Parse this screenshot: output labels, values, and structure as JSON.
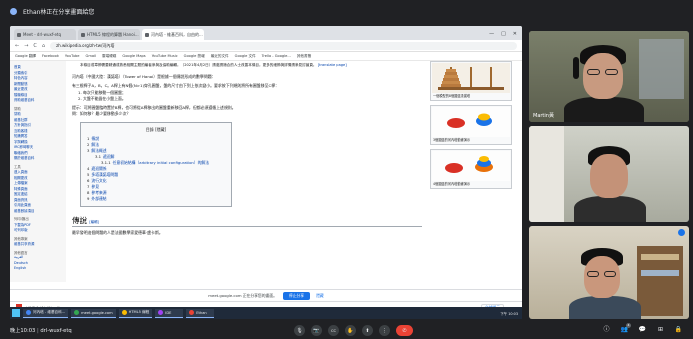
{
  "meeting": {
    "presenting_title": "Ethan林正在分享畫面給您",
    "code": "drl-wuxf-etq",
    "time": "晚上10:03"
  },
  "browser": {
    "tabs": [
      {
        "label": "Meet - drl-wuxf-etq",
        "active": false
      },
      {
        "label": "HTML5 線程的算題 Hanoi...",
        "active": false
      },
      {
        "label": "河內塔 - 維基百科，自由的...",
        "active": true
      }
    ],
    "window_controls": [
      "—",
      "□",
      "✕"
    ],
    "nav": [
      "←",
      "→",
      "C",
      "⌂"
    ],
    "url": "zh.wikipedia.org/zh-tw/河內塔",
    "bookmarks": [
      "Google 翻譯",
      "Facebook",
      "YouTube",
      "Gmail",
      "雲端硬碟",
      "Google Maps",
      "YouTube Music",
      "Google 簡報",
      "最近的文件",
      "Google 文件",
      "Trello - Google...",
      "其他書籤"
    ]
  },
  "wiki": {
    "sidebar_items": [
      "首頁",
      "分類索引",
      "特色內容",
      "新聞動態",
      "最近更改",
      "隨機條目",
      "資助維基百科"
    ],
    "sidebar_section_help": "幫助",
    "sidebar_help_items": [
      "幫助",
      "維基社群",
      "方針與指引",
      "互助客棧",
      "知識問答",
      "字詞轉換",
      "IRC即時聊天",
      "聯絡我們",
      "關於維基百科"
    ],
    "sidebar_section_tools": "工具",
    "sidebar_tool_items": [
      "連入頁面",
      "相關更改",
      "上傳檔案",
      "特殊頁面",
      "固定連結",
      "頁面資訊",
      "引用此頁面",
      "維基數據項目"
    ],
    "sidebar_section_print": "列印/匯出",
    "sidebar_print_items": [
      "下載為PDF",
      "可列印版"
    ],
    "sidebar_section_other": "其他專案",
    "sidebar_other_items": [
      "維基共享資源"
    ],
    "sidebar_section_lang": "其他語言",
    "sidebar_lang_items": [
      "العربية",
      "Deutsch",
      "English"
    ],
    "notice_text": "本條目或章節需要精通或熟悉相關主題的編者參與及協助編輯。（2021年4月2日）請邀請適合的人士改善本條目。更多的細節與詳情請參見討論頁。",
    "notice_link": "[translate page]",
    "intro": "河內塔（中國大陸：漢諾塔）（Tower of Hanoi）是根據一個傳說形成的數學問題：",
    "rule_intro": "有三根桿子A，B，C。A桿上有N個(N>1)穿孔圓盤，盤的尺寸由下到上依次變小。要求按下列規則將所有圓盤移至C桿：",
    "rules": [
      "1. 每次只能移動一個圓盤；",
      "2. 大盤不能疊在小盤上面。"
    ],
    "hint": "提示：可將圓盤臨時置於B桿，也可將從A桿移出的圓盤重新移回A桿，但都必須遵循上述規則。",
    "question": "問：如何移？最少要移動多少次？",
    "toc_title": "目錄 [隱藏]",
    "toc": [
      {
        "n": "1",
        "label": "傳說",
        "level": 0
      },
      {
        "n": "2",
        "label": "解法",
        "level": 0
      },
      {
        "n": "3",
        "label": "解法概述",
        "level": 0
      },
      {
        "n": "3.1",
        "label": "遞迴解",
        "level": 1
      },
      {
        "n": "3.1.1",
        "label": "任意初始結構（arbitrary initial configuration）的解法",
        "level": 2
      },
      {
        "n": "4",
        "label": "遞迴關係",
        "level": 0
      },
      {
        "n": "5",
        "label": "多塔漢諾塔問題",
        "level": 0
      },
      {
        "n": "6",
        "label": "流行文化",
        "level": 0
      },
      {
        "n": "7",
        "label": "參見",
        "level": 0
      },
      {
        "n": "8",
        "label": "參考來源",
        "level": 0
      },
      {
        "n": "9",
        "label": "外部連結",
        "level": 0
      }
    ],
    "section_heading": "傳說",
    "section_edit": "[編輯]",
    "section_text": "最早發明這個問題的人是法國數學家愛德華·盧卡斯。",
    "thumb_captions": [
      "一個模型的8個圓盤漢諾塔",
      "3個圓盤的河內塔動畫演示",
      "4個圓盤的河內塔動畫演示"
    ]
  },
  "share_notice": {
    "text": "meet.google.com 正在分享您的畫面。",
    "stop_label": "停止分享",
    "hide_label": "隱藏"
  },
  "downloads": {
    "file": "HW3-1 (1) (1).pdf",
    "show_all": "全部顯示"
  },
  "taskbar": {
    "apps": [
      "河內塔 - 維基百科...",
      "meet.google.com",
      "HTML5 線程",
      "IDE",
      "Ethan"
    ],
    "clock": "下午 10:03"
  },
  "participants": [
    {
      "name": "Martin黃"
    },
    {
      "name": ""
    },
    {
      "name": ""
    }
  ],
  "meet_controls": {
    "mic": "🎙",
    "cam": "📷",
    "cc": "CC",
    "raise": "✋",
    "present": "⬆",
    "more": "⋮",
    "end": "✆"
  },
  "meet_right": {
    "info": "ⓘ",
    "people": "👥",
    "people_count": "4",
    "chat": "💬",
    "activities": "⊞",
    "lock": "🔒"
  },
  "colors": {
    "meet_bg": "#202124",
    "end_call": "#ea4335",
    "share_blue": "#1a73e8"
  }
}
